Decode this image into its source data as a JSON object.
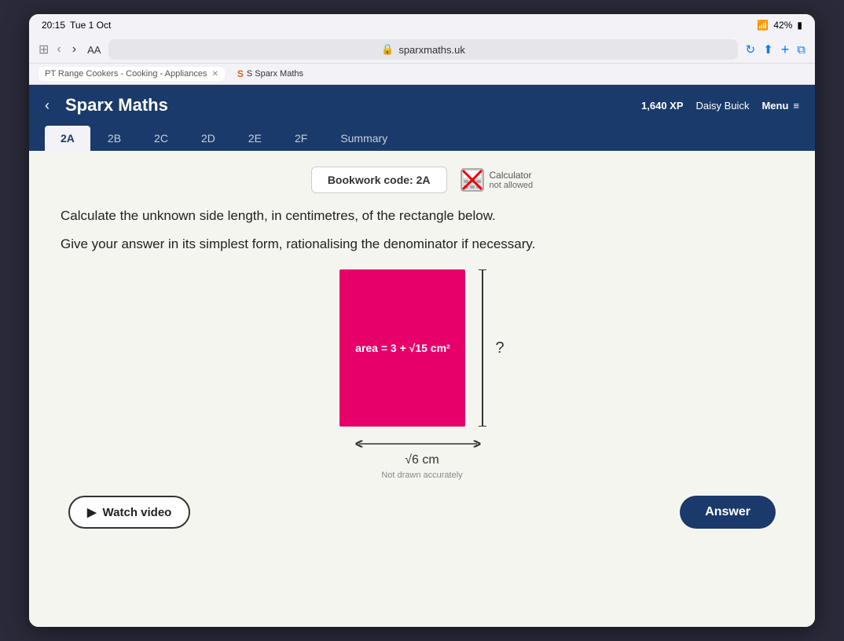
{
  "status": {
    "time": "20:15",
    "day": "Tue 1 Oct",
    "dots": "•••",
    "wifi": "42%",
    "battery_icon": "▮"
  },
  "browser": {
    "aa_label": "AA",
    "url": "sparxmaths.uk",
    "lock_icon": "🔒",
    "back_icon": "‹",
    "forward_icon": "›",
    "refresh_icon": "↻",
    "share_icon": "↑",
    "add_icon": "+",
    "tabs_icon": "⧉"
  },
  "tabs": {
    "tab1_label": "PT Range Cookers - Cooking - Appliances",
    "tab2_label": "S Sparx Maths"
  },
  "sparx": {
    "title": "Sparx Maths",
    "xp": "1,640 XP",
    "user": "Daisy Buick",
    "menu_label": "Menu",
    "back_icon": "‹"
  },
  "nav_tabs": [
    {
      "id": "2A",
      "label": "2A",
      "active": true
    },
    {
      "id": "2B",
      "label": "2B",
      "active": false
    },
    {
      "id": "2C",
      "label": "2C",
      "active": false
    },
    {
      "id": "2D",
      "label": "2D",
      "active": false
    },
    {
      "id": "2E",
      "label": "2E",
      "active": false
    },
    {
      "id": "2F",
      "label": "2F",
      "active": false
    },
    {
      "id": "Summary",
      "label": "Summary",
      "active": false
    }
  ],
  "content": {
    "bookwork_label": "Bookwork code: 2A",
    "calculator_label": "Calculator",
    "calculator_sub": "not allowed",
    "question_line1": "Calculate the unknown side length, in centimetres, of the rectangle below.",
    "question_line2": "Give your answer in its simplest form, rationalising the denominator if necessary.",
    "area_label": "area = 3 + √15 cm²",
    "width_label": "√6 cm",
    "unknown_label": "?",
    "not_drawn": "Not drawn accurately",
    "watch_video": "Watch video",
    "answer": "Answer"
  }
}
